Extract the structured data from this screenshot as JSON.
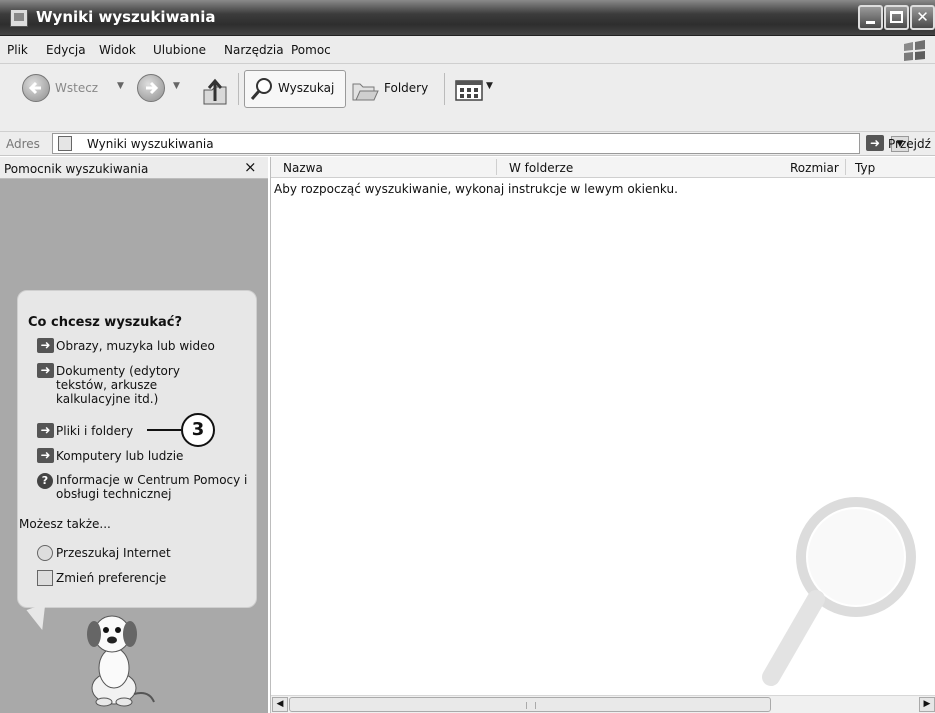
{
  "window": {
    "title": "Wyniki wyszukiwania"
  },
  "menubar": {
    "items": [
      "Plik",
      "Edycja",
      "Widok",
      "Ulubione",
      "Narzędzia",
      "Pomoc"
    ]
  },
  "toolbar": {
    "back_label": "Wstecz",
    "search_label": "Wyszukaj",
    "folders_label": "Foldery"
  },
  "address": {
    "label": "Adres",
    "value": "Wyniki wyszukiwania",
    "go_label": "Przejdź"
  },
  "left_pane": {
    "title": "Pomocnik wyszukiwania",
    "close_glyph": "×",
    "question": "Co chcesz wyszukać?",
    "options": [
      "Obrazy, muzyka lub wideo",
      "Dokumenty (edytory tekstów, arkusze kalkulacyjne itd.)",
      "Pliki i foldery",
      "Komputery lub ludzie",
      "Informacje w Centrum Pomocy i obsługi technicznej"
    ],
    "also_label": "Możesz także...",
    "also_items": [
      "Przeszukaj Internet",
      "Zmień preferencje"
    ],
    "callout_number": "3"
  },
  "results": {
    "columns": [
      "Nazwa",
      "W folderze",
      "Rozmiar",
      "Typ"
    ],
    "message": "Aby rozpocząć wyszukiwanie, wykonaj instrukcje w lewym okienku."
  },
  "icons": {
    "title": "search-results-icon",
    "back": "back-arrow-icon",
    "forward": "forward-arrow-icon",
    "up": "up-folder-icon",
    "search": "magnifier-icon",
    "folders": "folders-icon",
    "views": "views-icon",
    "go": "go-arrow-icon"
  }
}
